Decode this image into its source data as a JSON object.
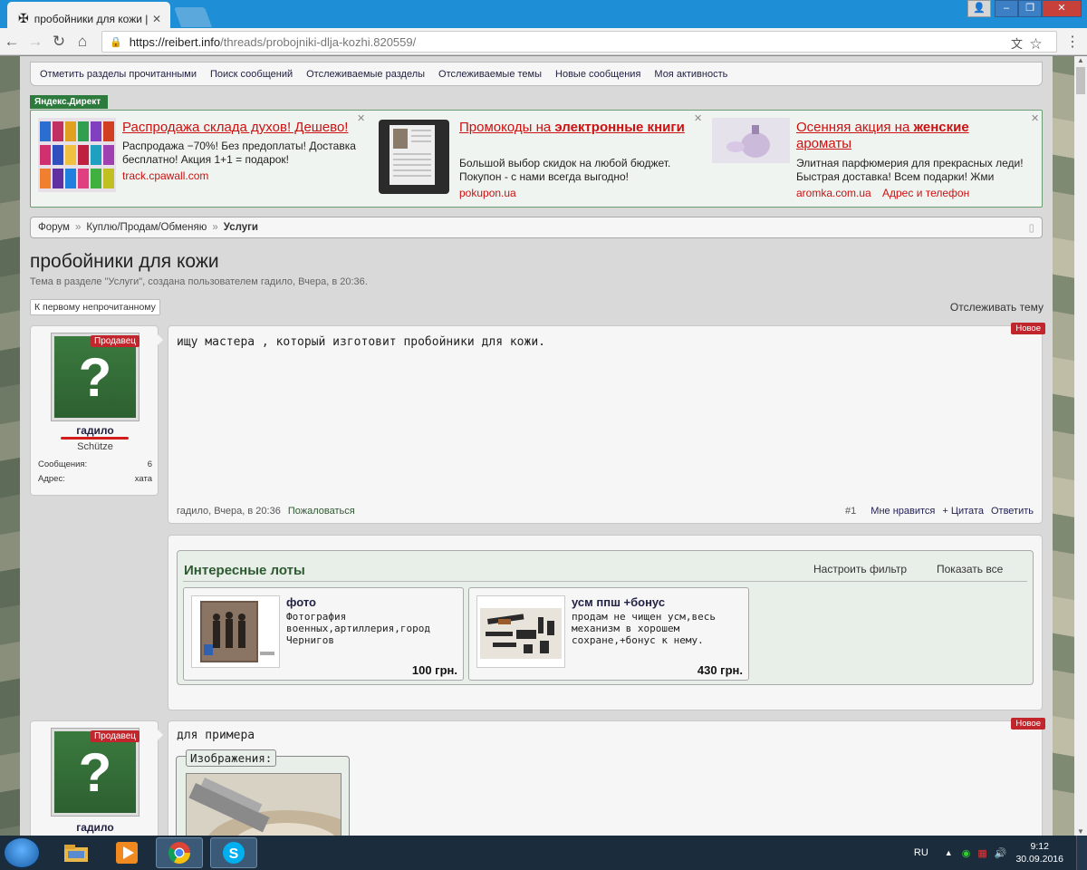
{
  "browser": {
    "tab_title": "пробойники для кожи |",
    "url_host": "https://reibert.info",
    "url_path": "/threads/probojniki-dlja-kozhi.820559/"
  },
  "subnav": [
    "Отметить разделы прочитанными",
    "Поиск сообщений",
    "Отслеживаемые разделы",
    "Отслеживаемые темы",
    "Новые сообщения",
    "Моя активность"
  ],
  "yandex_label": "Яндекс.Директ",
  "ads": [
    {
      "title_plain": "Распродажа склада духов! Дешево!",
      "title_bold": "",
      "desc": "Распродажа −70%! Без предоплаты! Доставка бесплатно! Акция 1+1 = подарок!",
      "url": "track.cpawall.com",
      "extra": ""
    },
    {
      "title_plain": "Промокоды на ",
      "title_bold": "электронные книги",
      "desc": "Большой выбор скидок на любой бюджет. Покупон - с нами всегда выгодно!",
      "url": "pokupon.ua",
      "extra": ""
    },
    {
      "title_plain": "Осенняя акция на ",
      "title_bold": "женские",
      "title_tail": " ароматы",
      "desc": "Элитная парфюмерия для прекрасных леди! Быстрая доставка! Всем подарки! Жми",
      "url": "aromka.com.ua",
      "extra": "Адрес и телефон"
    }
  ],
  "breadcrumb": {
    "items": [
      "Форум",
      "Куплю/Продам/Обменяю"
    ],
    "current": "Услуги"
  },
  "thread": {
    "title": "пробойники для кожи",
    "meta": "Тема в разделе \"Услуги\", создана пользователем гадило, Вчера, в 20:36.",
    "unread_btn": "К первому непрочитанному",
    "watch": "Отслеживать тему"
  },
  "post1": {
    "seller_badge": "Продавец",
    "username": "гадило",
    "rank": "Schütze",
    "stats": [
      {
        "k": "Сообщения:",
        "v": "6"
      },
      {
        "k": "Адрес:",
        "v": "хата"
      }
    ],
    "new_badge": "Новое",
    "text": "ищу мастера , который изготовит пробойники для кожи.",
    "author_time": "гадило, Вчера, в 20:36",
    "report": "Пожаловаться",
    "num": "#1",
    "dislike": "Мне нравится",
    "quote": "+ Цитата",
    "reply": "Ответить"
  },
  "lots": {
    "title": "Интересные лоты",
    "filter": "Настроить фильтр",
    "show_all": "Показать все",
    "items": [
      {
        "name": "фото",
        "desc": "Фотография военных,артиллерия,город Чернигов",
        "price": "100 грн."
      },
      {
        "name": "усм ппш +бонус",
        "desc": "продам не чищен усм,весь механизм в хорошем сохране,+бонус к нему.",
        "price": "430 грн."
      }
    ]
  },
  "post2": {
    "seller_badge": "Продавец",
    "username": "гадило",
    "new_badge": "Новое",
    "text": "для примера",
    "gallery_label": "Изображения:"
  },
  "taskbar": {
    "lang": "RU",
    "time": "9:12",
    "date": "30.09.2016"
  }
}
